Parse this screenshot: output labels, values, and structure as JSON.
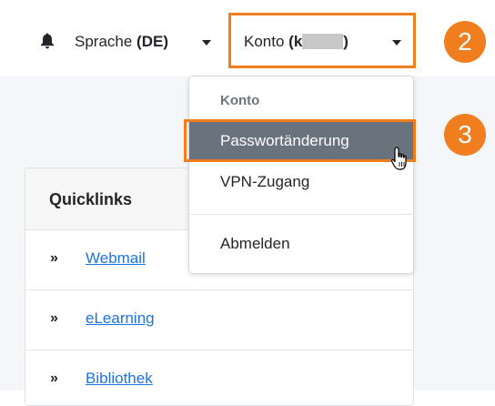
{
  "navbar": {
    "language_label": "Sprache ",
    "language_code": "(DE)",
    "account_label": "Konto ",
    "account_user_prefix": "(k",
    "account_user_suffix": ")"
  },
  "steps": {
    "step2": "2",
    "step3": "3"
  },
  "dropdown": {
    "header": "Konto",
    "items": [
      "Passwortänderung",
      "VPN-Zugang",
      "Abmelden"
    ]
  },
  "quicklinks": {
    "title": "Quicklinks",
    "chevron": "»",
    "items": [
      "Webmail",
      "eLearning",
      "Bibliothek"
    ]
  },
  "colors": {
    "accent": "#f07e1e",
    "active_item": "#69737d",
    "link": "#1a73e8"
  }
}
